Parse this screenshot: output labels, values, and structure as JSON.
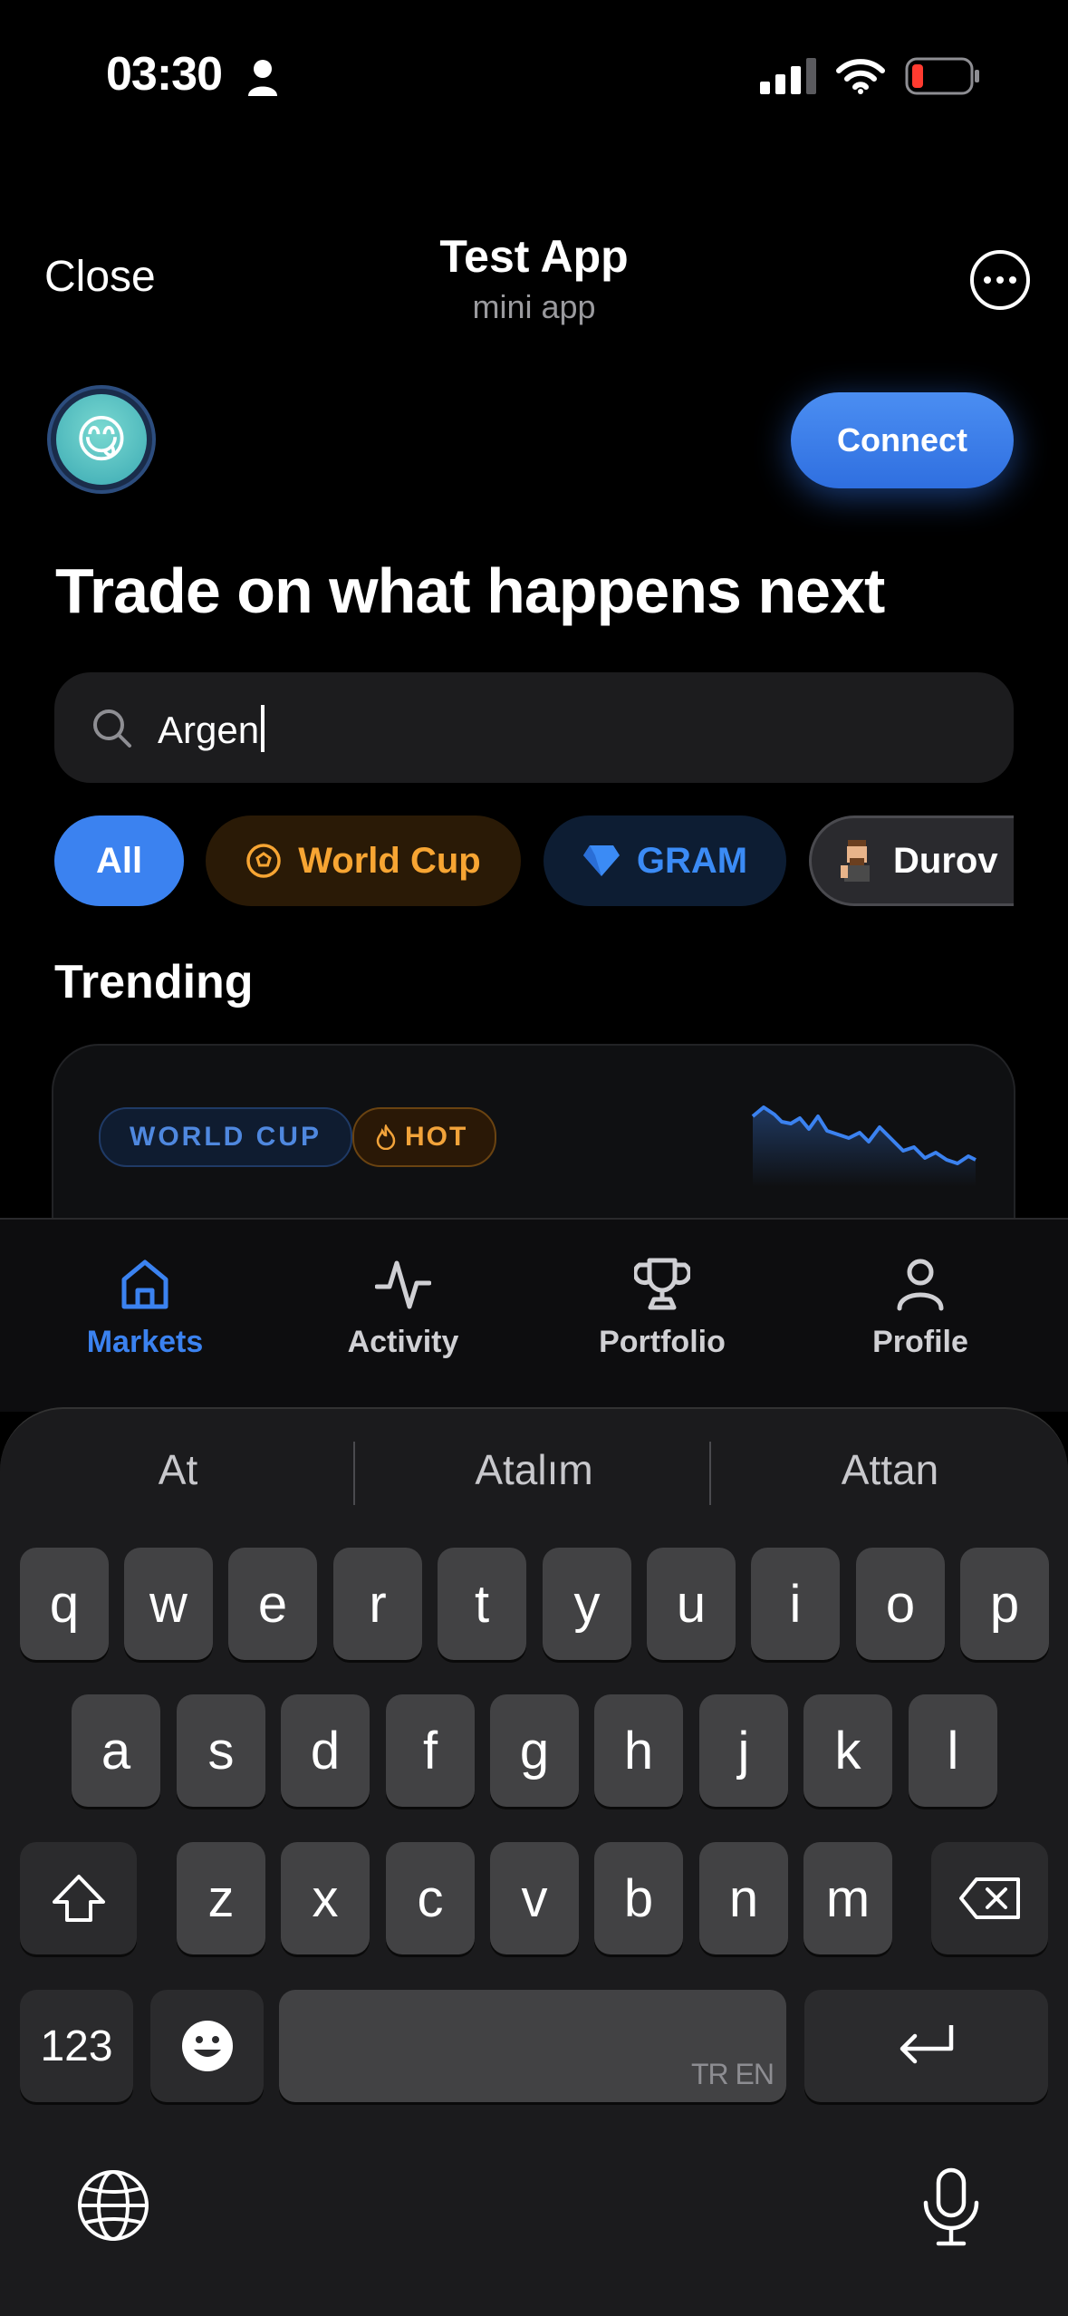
{
  "status_bar": {
    "time": "03:30"
  },
  "header": {
    "close_label": "Close",
    "title": "Test App",
    "subtitle": "mini app"
  },
  "top": {
    "avatar_emoji": "😋",
    "connect_label": "Connect"
  },
  "headline": "Trade on what happens next",
  "search": {
    "value": "Argen",
    "placeholder": ""
  },
  "chips": [
    {
      "label": "All",
      "active": true
    },
    {
      "label": "World Cup",
      "icon": "soccer-ball-icon"
    },
    {
      "label": "GRAM",
      "icon": "diamond-icon"
    },
    {
      "label": "Durov",
      "icon": "durov-avatar-icon"
    }
  ],
  "section_title": "Trending",
  "trending_card": {
    "tag_category": "WORLD CUP",
    "tag_hot": "HOT"
  },
  "bottom_nav": [
    {
      "label": "Markets",
      "icon": "home-icon",
      "active": true
    },
    {
      "label": "Activity",
      "icon": "activity-icon"
    },
    {
      "label": "Portfolio",
      "icon": "trophy-icon"
    },
    {
      "label": "Profile",
      "icon": "person-icon"
    }
  ],
  "keyboard": {
    "suggestions": [
      "At",
      "Atalım",
      "Attan"
    ],
    "row1": [
      "q",
      "w",
      "e",
      "r",
      "t",
      "y",
      "u",
      "i",
      "o",
      "p"
    ],
    "row2": [
      "a",
      "s",
      "d",
      "f",
      "g",
      "h",
      "j",
      "k",
      "l"
    ],
    "row3": [
      "z",
      "x",
      "c",
      "v",
      "b",
      "n",
      "m"
    ],
    "numbers_label": "123",
    "space_lang": "TR EN"
  },
  "colors": {
    "accent": "#3b82f0",
    "world_cup": "#f7a533",
    "gram": "#3b8bf5",
    "background": "#000000"
  }
}
